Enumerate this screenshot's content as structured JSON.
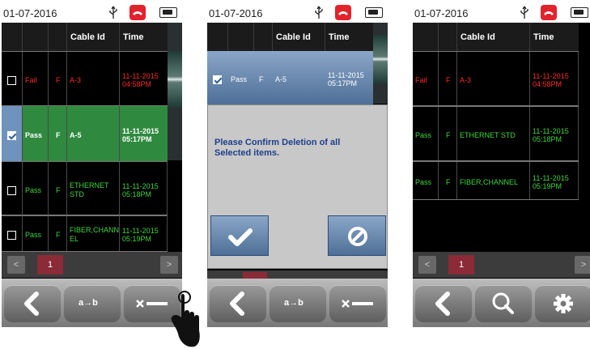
{
  "screens": [
    {
      "date": "01-07-2016",
      "headers": [
        "",
        "",
        "",
        "Cable Id",
        "Time"
      ],
      "rows": [
        {
          "checked": false,
          "status": "Fail",
          "flag": "F",
          "cable_id": "A-3",
          "time1": "11-11-2015",
          "time2": "04:58PM",
          "color": "red"
        },
        {
          "checked": true,
          "status": "Pass",
          "flag": "F",
          "cable_id": "A-5",
          "time1": "11-11-2015",
          "time2": "05:17PM",
          "color": "white",
          "selected": true
        },
        {
          "checked": false,
          "status": "Pass",
          "flag": "F",
          "cable_id": "ETHERNET STD",
          "time1": "11-11-2015",
          "time2": "05:18PM",
          "color": "green"
        },
        {
          "checked": false,
          "status": "Pass",
          "flag": "F",
          "cable_id": "FIBER,CHANNEL",
          "time1": "11-11-2015",
          "time2": "05:19PM",
          "color": "green"
        }
      ],
      "pager": {
        "prev": "<",
        "page": "1",
        "next": ">"
      },
      "toolbar": [
        "back-icon",
        "rename-icon",
        "delete-icon"
      ]
    },
    {
      "date": "01-07-2016",
      "headers": [
        "",
        "",
        "",
        "Cable Id",
        "Time"
      ],
      "rows": [
        {
          "checked": true,
          "status": "Pass",
          "flag": "F",
          "cable_id": "A-5",
          "time1": "11-11-2015",
          "time2": "05:17PM",
          "color": "white"
        }
      ],
      "dialog": {
        "message": "Please Confirm Deletion of all Selected items.",
        "confirm_icon": "check-icon",
        "cancel_icon": "cancel-icon"
      },
      "toolbar": [
        "back-icon",
        "rename-icon",
        "delete-icon"
      ]
    },
    {
      "date": "01-07-2016",
      "headers": [
        "",
        "",
        "Cable Id",
        "Time"
      ],
      "rows": [
        {
          "status": "Fail",
          "flag": "F",
          "cable_id": "A-3",
          "time1": "11-11-2015",
          "time2": "04:58PM",
          "color": "red"
        },
        {
          "status": "Pass",
          "flag": "F",
          "cable_id": "ETHERNET STD",
          "time1": "11-11-2015",
          "time2": "05:18PM",
          "color": "green"
        },
        {
          "status": "Pass",
          "flag": "F",
          "cable_id": "FIBER,CHANNEL",
          "time1": "11-11-2015",
          "time2": "05:19PM",
          "color": "green"
        }
      ],
      "pager": {
        "prev": "<",
        "page": "1",
        "next": ">"
      },
      "toolbar": [
        "back-icon",
        "search-icon",
        "settings-icon"
      ]
    }
  ],
  "rename_label": "a→b",
  "colors": {
    "fail": "#ff2a2a",
    "pass": "#3ed83e",
    "selected_row": "#2f8a3f",
    "dialog_text": "#1e3f8c",
    "page_active": "#8a2b37"
  }
}
